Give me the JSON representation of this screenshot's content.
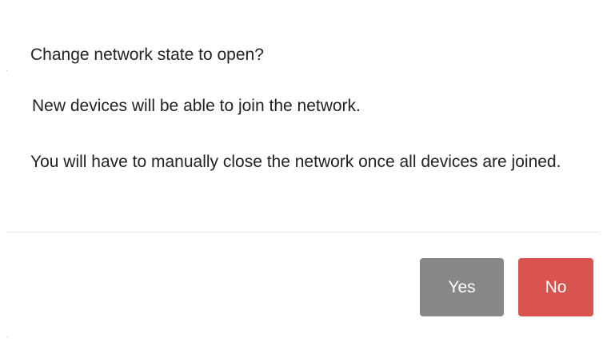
{
  "dialog": {
    "question": "Change network state to open?",
    "info": "New devices will be able to join the network.",
    "note": "You will have to manually close the network once all devices are joined."
  },
  "buttons": {
    "yes_label": "Yes",
    "no_label": "No"
  },
  "colors": {
    "yes_button": "#888888",
    "no_button": "#d9534f",
    "divider": "#e5e5e5"
  }
}
